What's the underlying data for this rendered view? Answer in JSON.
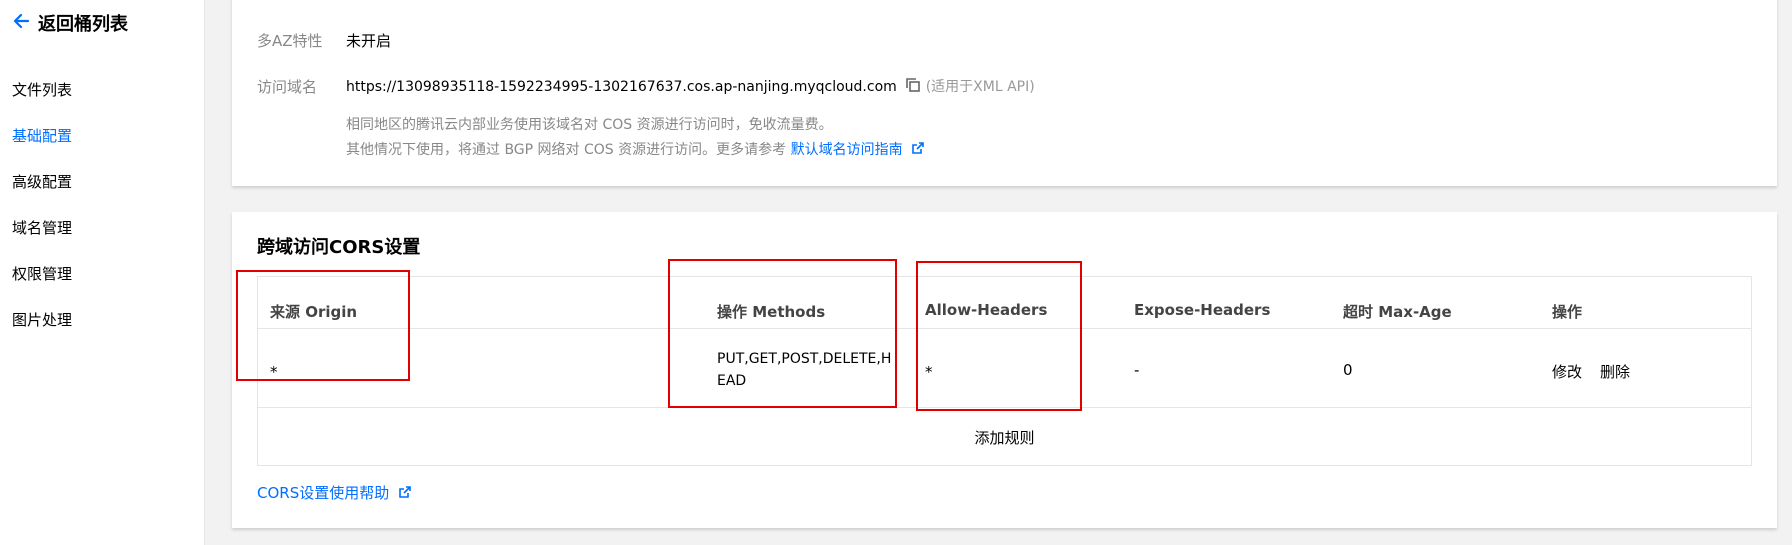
{
  "sidebar": {
    "back_label": "返回桶列表",
    "items": [
      {
        "label": "文件列表",
        "active": false
      },
      {
        "label": "基础配置",
        "active": true
      },
      {
        "label": "高级配置",
        "active": false
      },
      {
        "label": "域名管理",
        "active": false
      },
      {
        "label": "权限管理",
        "active": false
      },
      {
        "label": "图片处理",
        "active": false
      }
    ]
  },
  "basic": {
    "multi_az_label": "多AZ特性",
    "multi_az_value": "未开启",
    "domain_label": "访问域名",
    "domain_value": "https://13098935118-1592234995-1302167637.cos.ap-nanjing.myqcloud.com",
    "domain_note": "(适用于XML API)",
    "hint_line1": "相同地区的腾讯云内部业务使用该域名对 COS 资源进行访问时，免收流量费。",
    "hint_line2": "其他情况下使用，将通过 BGP 网络对 COS 资源进行访问。更多请参考",
    "hint_link": "默认域名访问指南"
  },
  "cors": {
    "title": "跨域访问CORS设置",
    "headers": [
      "来源 Origin",
      "操作 Methods",
      "Allow-Headers",
      "Expose-Headers",
      "超时 Max-Age",
      "操作"
    ],
    "rows": [
      {
        "origin": "*",
        "methods_line1": "PUT,GET,POST,DELETE,H",
        "methods_line2": "EAD",
        "allow_headers": "*",
        "expose_headers": "-",
        "max_age": "0",
        "edit_label": "修改",
        "delete_label": "删除"
      }
    ],
    "add_rule_label": "添加规则",
    "help_label": "CORS设置使用帮助"
  },
  "colors": {
    "accent": "#006eff",
    "highlight_box": "#e10000"
  }
}
